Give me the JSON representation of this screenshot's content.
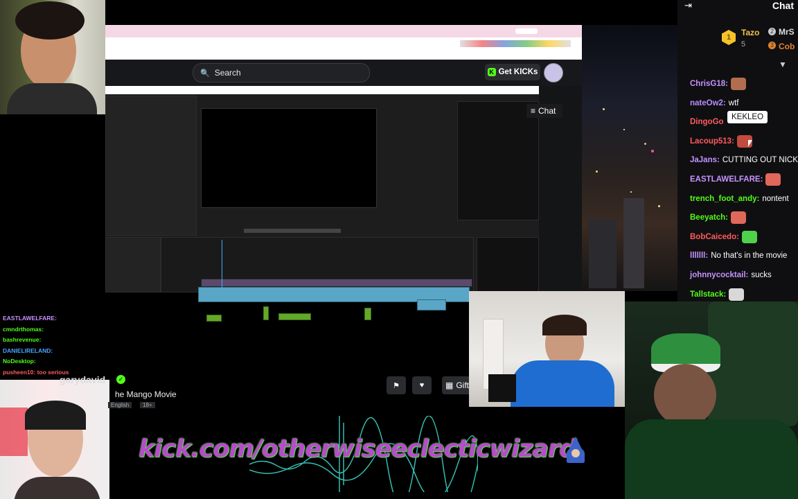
{
  "browser": {
    "search_placeholder": "Search",
    "get_kicks_label": "Get KICKs",
    "chat_button_label": "Chat",
    "kick_logo_letter": "K"
  },
  "premiere": {
    "window": "Adobe Premiere Pro"
  },
  "chat": {
    "title": "Chat",
    "leaderboard": [
      {
        "rank": "1",
        "name": "Tazo",
        "count": "5"
      },
      {
        "rank": "2",
        "name": "MrS"
      },
      {
        "rank": "3",
        "name": "Cob"
      }
    ],
    "tooltip": "KEKLEO",
    "messages": [
      {
        "user": "ChrisG18:",
        "text": "",
        "color": "#c792ff",
        "emote": "#b26d4e"
      },
      {
        "user": "nateOw2:",
        "text": "wtf",
        "color": "#b88cff",
        "emote": ""
      },
      {
        "user": "DingoGo",
        "text": "",
        "color": "#ff5c5c",
        "emote": ""
      },
      {
        "user": "Lacoup513:",
        "text": "",
        "color": "#ff5c5c",
        "emote": "#c24b3d"
      },
      {
        "user": "JaJans:",
        "text": "CUTTING OUT NICK",
        "color": "#c792ff",
        "emote": ""
      },
      {
        "user": "EASTLAWELFARE:",
        "text": "",
        "color": "#c792ff",
        "emote": "#e0685a"
      },
      {
        "user": "trench_foot_andy:",
        "text": "nontent",
        "color": "#53fc18",
        "emote": ""
      },
      {
        "user": "Beeyatch:",
        "text": "",
        "color": "#53fc18",
        "emote": "#e0685a"
      },
      {
        "user": "BobCaicedo:",
        "text": "",
        "color": "#ff5c5c",
        "emote": "#4fd14a"
      },
      {
        "user": "lllllll:",
        "text": "No that's in the movie",
        "color": "#c792ff",
        "emote": ""
      },
      {
        "user": "johnnycocktail:",
        "text": "sucks",
        "color": "#c792ff",
        "emote": ""
      },
      {
        "user": "Tallstack:",
        "text": "",
        "color": "#53fc18",
        "emote": "#d8d8d8"
      }
    ]
  },
  "stream": {
    "streamer_name": "garydavid",
    "title": "he Mango Movie",
    "tags": [
      "English",
      "18+"
    ],
    "gift_label": "Gift"
  },
  "overlay": {
    "url_text": "kick.com/otherwiseeclecticwizard"
  },
  "left_chat": [
    {
      "user": "EASTLAWELFARE:",
      "color": "#c792ff"
    },
    {
      "user": "cmndrthomas:",
      "color": "#53fc18"
    },
    {
      "user": "bashrevenue:",
      "color": "#53fc18"
    },
    {
      "user": "DANIELIRELAND:",
      "color": "#4aa3ff"
    },
    {
      "user": "NoDesktop:",
      "color": "#53fc18"
    },
    {
      "user": "pusheen10: too serious",
      "color": "#ff5c5c"
    }
  ]
}
